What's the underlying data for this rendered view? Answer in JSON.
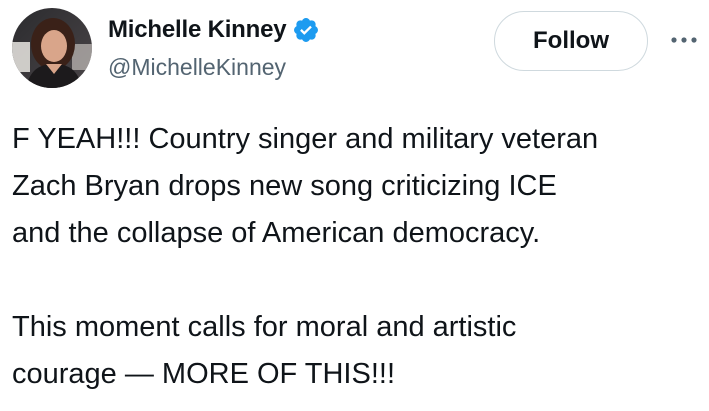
{
  "author": {
    "display_name": "Michelle Kinney",
    "handle": "@MichelleKinney",
    "verified": true
  },
  "actions": {
    "follow_label": "Follow",
    "more_icon": "more-horizontal-icon"
  },
  "tweet": {
    "lines": [
      "F YEAH!!! Country singer and military veteran",
      "Zach Bryan drops new song criticizing ICE",
      "and the collapse of American democracy.",
      "",
      "This moment calls for moral and artistic",
      "courage — MORE OF THIS!!!"
    ]
  },
  "colors": {
    "text_primary": "#0f1419",
    "text_secondary": "#536471",
    "verified_blue": "#1d9bf0",
    "button_border": "#cfd9de"
  }
}
